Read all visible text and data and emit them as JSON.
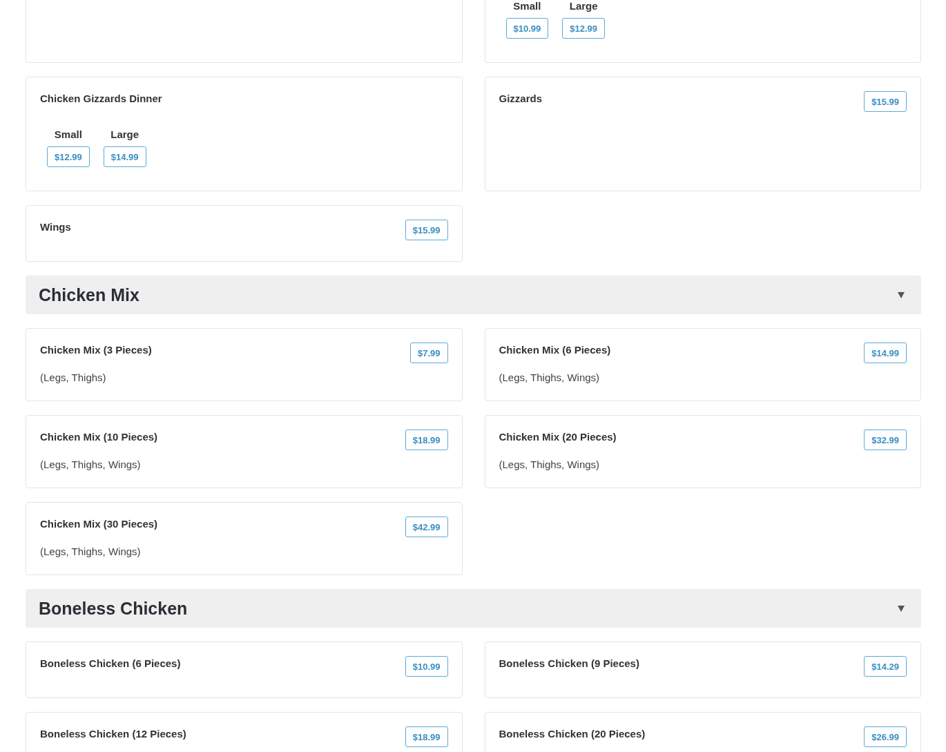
{
  "sections": [
    {
      "items": [
        {
          "kind": "empty"
        },
        {
          "kind": "sizes",
          "options": [
            {
              "label": "Small",
              "price": "$10.99"
            },
            {
              "label": "Large",
              "price": "$12.99"
            }
          ]
        },
        {
          "kind": "sizes",
          "name": "Chicken Gizzards Dinner",
          "options": [
            {
              "label": "Small",
              "price": "$12.99"
            },
            {
              "label": "Large",
              "price": "$14.99"
            }
          ]
        },
        {
          "kind": "single",
          "name": "Gizzards",
          "price": "$15.99"
        },
        {
          "kind": "single",
          "name": "Wings",
          "price": "$15.99"
        }
      ]
    },
    {
      "title": "Chicken Mix",
      "expanded": true,
      "items": [
        {
          "kind": "single",
          "name": "Chicken Mix (3 Pieces)",
          "price": "$7.99",
          "description": "(Legs, Thighs)"
        },
        {
          "kind": "single",
          "name": "Chicken Mix (6 Pieces)",
          "price": "$14.99",
          "description": "(Legs, Thighs, Wings)"
        },
        {
          "kind": "single",
          "name": "Chicken Mix (10 Pieces)",
          "price": "$18.99",
          "description": "(Legs, Thighs, Wings)"
        },
        {
          "kind": "single",
          "name": "Chicken Mix (20 Pieces)",
          "price": "$32.99",
          "description": "(Legs, Thighs, Wings)"
        },
        {
          "kind": "single",
          "name": "Chicken Mix (30 Pieces)",
          "price": "$42.99",
          "description": "(Legs, Thighs, Wings)"
        }
      ]
    },
    {
      "title": "Boneless Chicken",
      "expanded": true,
      "items": [
        {
          "kind": "single",
          "name": "Boneless Chicken (6 Pieces)",
          "price": "$10.99"
        },
        {
          "kind": "single",
          "name": "Boneless Chicken (9 Pieces)",
          "price": "$14.29"
        },
        {
          "kind": "single",
          "name": "Boneless Chicken (12 Pieces)",
          "price": "$18.99"
        },
        {
          "kind": "single",
          "name": "Boneless Chicken (20 Pieces)",
          "price": "$26.99"
        }
      ]
    }
  ]
}
